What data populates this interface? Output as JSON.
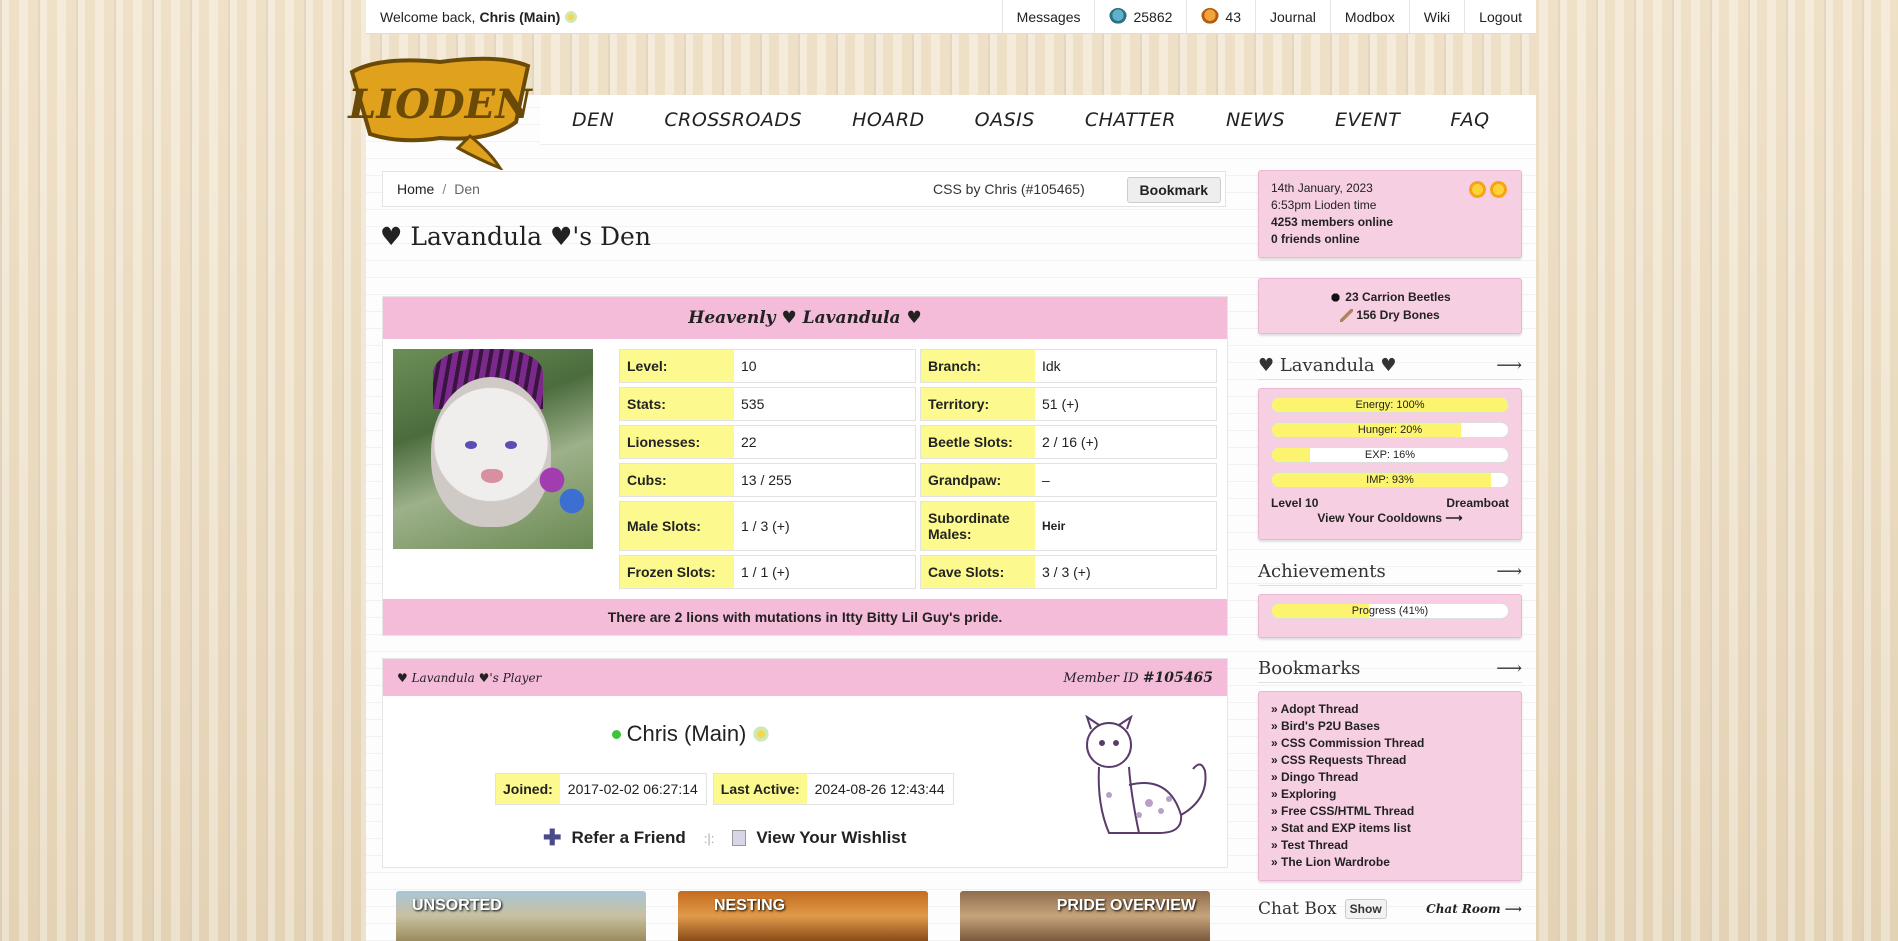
{
  "topbar": {
    "welcome_prefix": "Welcome back,",
    "user": "Chris (Main)",
    "messages": "Messages",
    "beetles_blue": "25862",
    "beetles_orange": "43",
    "journal": "Journal",
    "modbox": "Modbox",
    "wiki": "Wiki",
    "logout": "Logout"
  },
  "logo_text": "LIODEN",
  "nav": [
    "DEN",
    "CROSSROADS",
    "HOARD",
    "OASIS",
    "CHATTER",
    "NEWS",
    "EVENT",
    "FAQ"
  ],
  "breadcrumb": {
    "home": "Home",
    "sep": "/",
    "current": "Den",
    "css_credit": "CSS by Chris (#105465)",
    "bookmark": "Bookmark"
  },
  "page_title": "♥ Lavandula ♥'s Den",
  "den": {
    "title": "Heavenly ♥ Lavandula ♥",
    "stats": [
      {
        "k": "Level:",
        "v": "10"
      },
      {
        "k": "Branch:",
        "v": "Idk"
      },
      {
        "k": "Stats:",
        "v": "535"
      },
      {
        "k": "Territory:",
        "v": "51 (+)"
      },
      {
        "k": "Lionesses:",
        "v": "22"
      },
      {
        "k": "Beetle Slots:",
        "v": "2 / 16 (+)"
      },
      {
        "k": "Cubs:",
        "v": "13 / 255"
      },
      {
        "k": "Grandpaw:",
        "v": "–"
      },
      {
        "k": "Male Slots:",
        "v": "1 / 3 (+)"
      },
      {
        "k": "Subordinate Males:",
        "v": "Heir"
      },
      {
        "k": "Frozen Slots:",
        "v": "1 / 1 (+)"
      },
      {
        "k": "Cave Slots:",
        "v": "3 / 3 (+)"
      }
    ],
    "mutation_notice": "There are 2 lions with mutations in Itty Bitty Lil Guy's pride."
  },
  "player": {
    "head_left": "♥ Lavandula ♥'s Player",
    "head_right_prefix": "Member ID",
    "member_id": "#105465",
    "name": "Chris (Main)",
    "joined_label": "Joined:",
    "joined": "2017-02-02 06:27:14",
    "last_active_label": "Last Active:",
    "last_active": "2024-08-26 12:43:44",
    "refer": "Refer a Friend",
    "sep": ":|:",
    "wishlist": "View Your Wishlist"
  },
  "tiles": [
    "UNSORTED",
    "NESTING",
    "PRIDE OVERVIEW"
  ],
  "sidebar": {
    "date": "14th January, 2023",
    "time": "6:53pm Lioden time",
    "members": "4253 members online",
    "friends": "0 friends online",
    "carrion": "23 Carrion Beetles",
    "bones": "156 Dry Bones",
    "lion_heading": "♥ Lavandula ♥",
    "arrow": "⟶",
    "bars": [
      {
        "label": "Energy: 100%",
        "pct": 100
      },
      {
        "label": "Hunger: 20%",
        "pct": 80
      },
      {
        "label": "EXP: 16%",
        "pct": 16
      },
      {
        "label": "IMP: 93%",
        "pct": 93
      }
    ],
    "level": "Level 10",
    "title": "Dreamboat",
    "cooldowns": "View Your Cooldowns ⟶",
    "achievements_heading": "Achievements",
    "progress_label": "Progress (41%)",
    "progress_pct": 41,
    "bookmarks_heading": "Bookmarks",
    "bookmarks": [
      "» Adopt Thread",
      "» Bird's P2U Bases",
      "» CSS Commission Thread",
      "» CSS Requests Thread",
      "» Dingo Thread",
      "» Exploring",
      "» Free CSS/HTML Thread",
      "» Stat and EXP items list",
      "» Test Thread",
      "» The Lion Wardrobe"
    ],
    "chat_heading": "Chat Box",
    "chat_show": "Show",
    "chat_room": "Chat Room ⟶"
  },
  "colors": {
    "pink": "#f4bcd9",
    "yellow": "#fcfa8e",
    "online": "#3cc43c"
  }
}
